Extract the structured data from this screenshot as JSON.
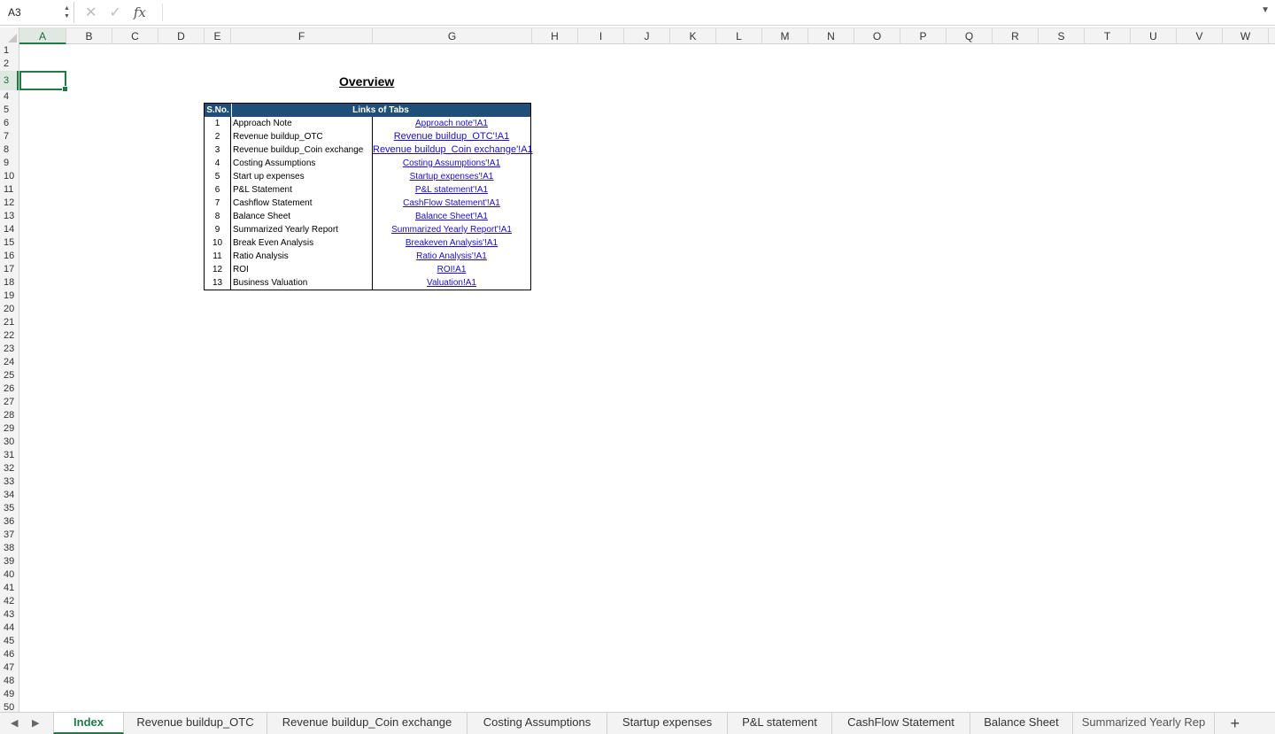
{
  "formula_bar": {
    "name_box": "A3",
    "cancel_glyph": "✕",
    "enter_glyph": "✓",
    "fx_label": "fx",
    "formula": ""
  },
  "columns": [
    "A",
    "B",
    "C",
    "D",
    "E",
    "F",
    "G",
    "H",
    "I",
    "J",
    "K",
    "L",
    "M",
    "N",
    "O",
    "P",
    "Q",
    "R",
    "S",
    "T",
    "U",
    "V",
    "W"
  ],
  "selected_cell": {
    "col": "A",
    "row": 3
  },
  "rows_visible": 50,
  "title": "Overview",
  "table": {
    "header_sno": "S.No.",
    "header_links": "Links of Tabs",
    "rows": [
      {
        "sno": "1",
        "name": "Approach Note",
        "link": "Approach note'!A1"
      },
      {
        "sno": "2",
        "name": "Revenue buildup_OTC",
        "link": "Revenue buildup_OTC'!A1"
      },
      {
        "sno": "3",
        "name": "Revenue buildup_Coin exchange",
        "link": "Revenue buildup_Coin exchange'!A1"
      },
      {
        "sno": "4",
        "name": "Costing Assumptions",
        "link": "Costing Assumptions'!A1"
      },
      {
        "sno": "5",
        "name": "Start up expenses",
        "link": "Startup expenses'!A1"
      },
      {
        "sno": "6",
        "name": "P&L Statement",
        "link": "P&L statement'!A1"
      },
      {
        "sno": "7",
        "name": "Cashflow Statement",
        "link": "CashFlow Statement'!A1"
      },
      {
        "sno": "8",
        "name": "Balance Sheet",
        "link": "Balance Sheet'!A1"
      },
      {
        "sno": "9",
        "name": "Summarized Yearly Report",
        "link": "Summarized Yearly Report'!A1"
      },
      {
        "sno": "10",
        "name": "Break Even Analysis",
        "link": "Breakeven Analysis'!A1"
      },
      {
        "sno": "11",
        "name": "Ratio Analysis",
        "link": "Ratio Analysis'!A1"
      },
      {
        "sno": "12",
        "name": "ROI",
        "link": "ROI!A1"
      },
      {
        "sno": "13",
        "name": "Business Valuation",
        "link": "Valuation!A1"
      }
    ]
  },
  "sheet_tabs": [
    "Index",
    "Revenue buildup_OTC",
    "Revenue buildup_Coin exchange",
    "Costing Assumptions",
    "Startup expenses",
    "P&L statement",
    "CashFlow Statement",
    "Balance Sheet",
    "Summarized Yearly Rep"
  ],
  "active_tab": "Index",
  "colors": {
    "accent": "#1f7a45",
    "table_header": "#1f4e79",
    "link": "#1a0dcc"
  }
}
